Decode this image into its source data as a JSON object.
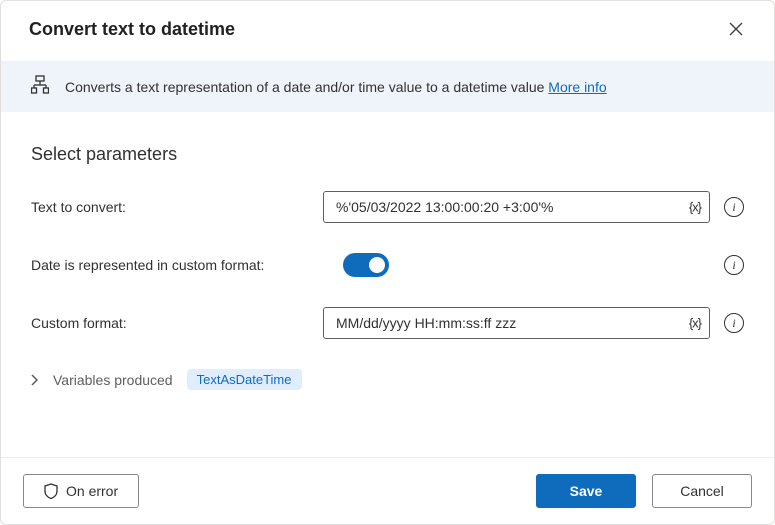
{
  "header": {
    "title": "Convert text to datetime"
  },
  "banner": {
    "description": "Converts a text representation of a date and/or time value to a datetime value ",
    "more_info": "More info"
  },
  "section": {
    "heading": "Select parameters"
  },
  "params": {
    "text_to_convert_label": "Text to convert:",
    "text_to_convert_value": "%'05/03/2022 13:00:00:20 +3:00'%",
    "custom_format_toggle_label": "Date is represented in custom format:",
    "custom_format_toggle_on": true,
    "custom_format_label": "Custom format:",
    "custom_format_value": "MM/dd/yyyy HH:mm:ss:ff zzz",
    "var_badge": "{x}"
  },
  "variables": {
    "produced_label": "Variables produced",
    "output_name": "TextAsDateTime"
  },
  "footer": {
    "on_error": "On error",
    "save": "Save",
    "cancel": "Cancel"
  }
}
